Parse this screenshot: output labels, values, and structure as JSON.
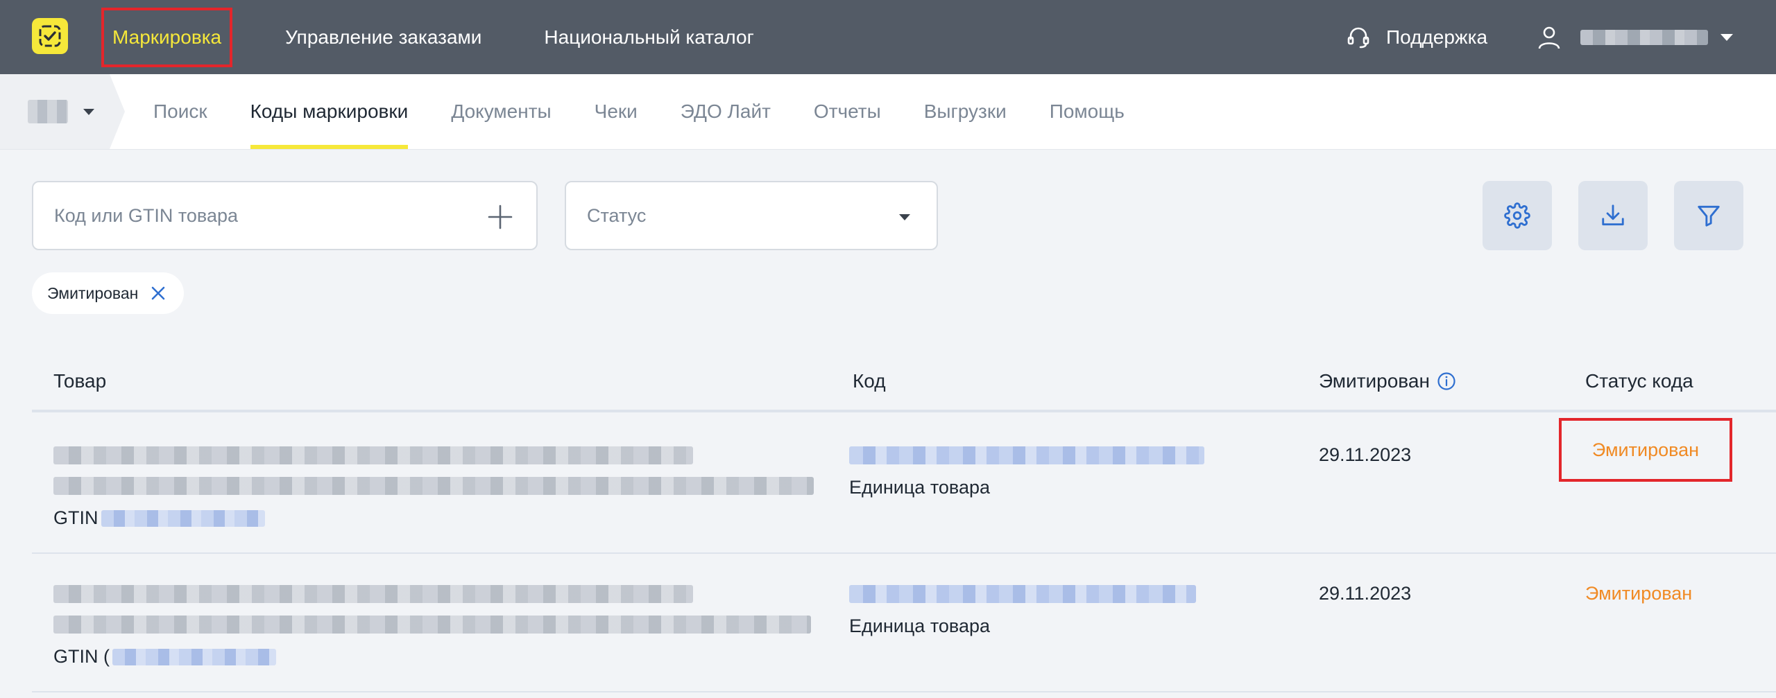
{
  "topbar": {
    "nav": [
      {
        "label": "Маркировка",
        "active": true
      },
      {
        "label": "Управление заказами"
      },
      {
        "label": "Национальный каталог"
      }
    ],
    "support_label": "Поддержка"
  },
  "subnav": {
    "tabs": [
      {
        "label": "Поиск"
      },
      {
        "label": "Коды маркировки",
        "active": true
      },
      {
        "label": "Документы"
      },
      {
        "label": "Чеки"
      },
      {
        "label": "ЭДО Лайт"
      },
      {
        "label": "Отчеты"
      },
      {
        "label": "Выгрузки"
      },
      {
        "label": "Помощь"
      }
    ]
  },
  "filters": {
    "search_placeholder": "Код или GTIN товара",
    "status_placeholder": "Статус",
    "active_chip": "Эмитирован"
  },
  "table": {
    "headers": {
      "product": "Товар",
      "code": "Код",
      "emitted": "Эмитирован",
      "status": "Статус кода"
    },
    "rows": [
      {
        "gtin_label": "GTIN",
        "unit": "Единица товара",
        "date": "29.11.2023",
        "status": "Эмитирован"
      },
      {
        "gtin_label": "GTIN (",
        "unit": "Единица товара",
        "date": "29.11.2023",
        "status": "Эмитирован"
      }
    ]
  },
  "colors": {
    "topbar": "#535b66",
    "accent_yellow": "#f6e83a",
    "highlight_red": "#e3262b",
    "status_orange": "#f08a24",
    "icon_blue": "#2f6fd0"
  }
}
